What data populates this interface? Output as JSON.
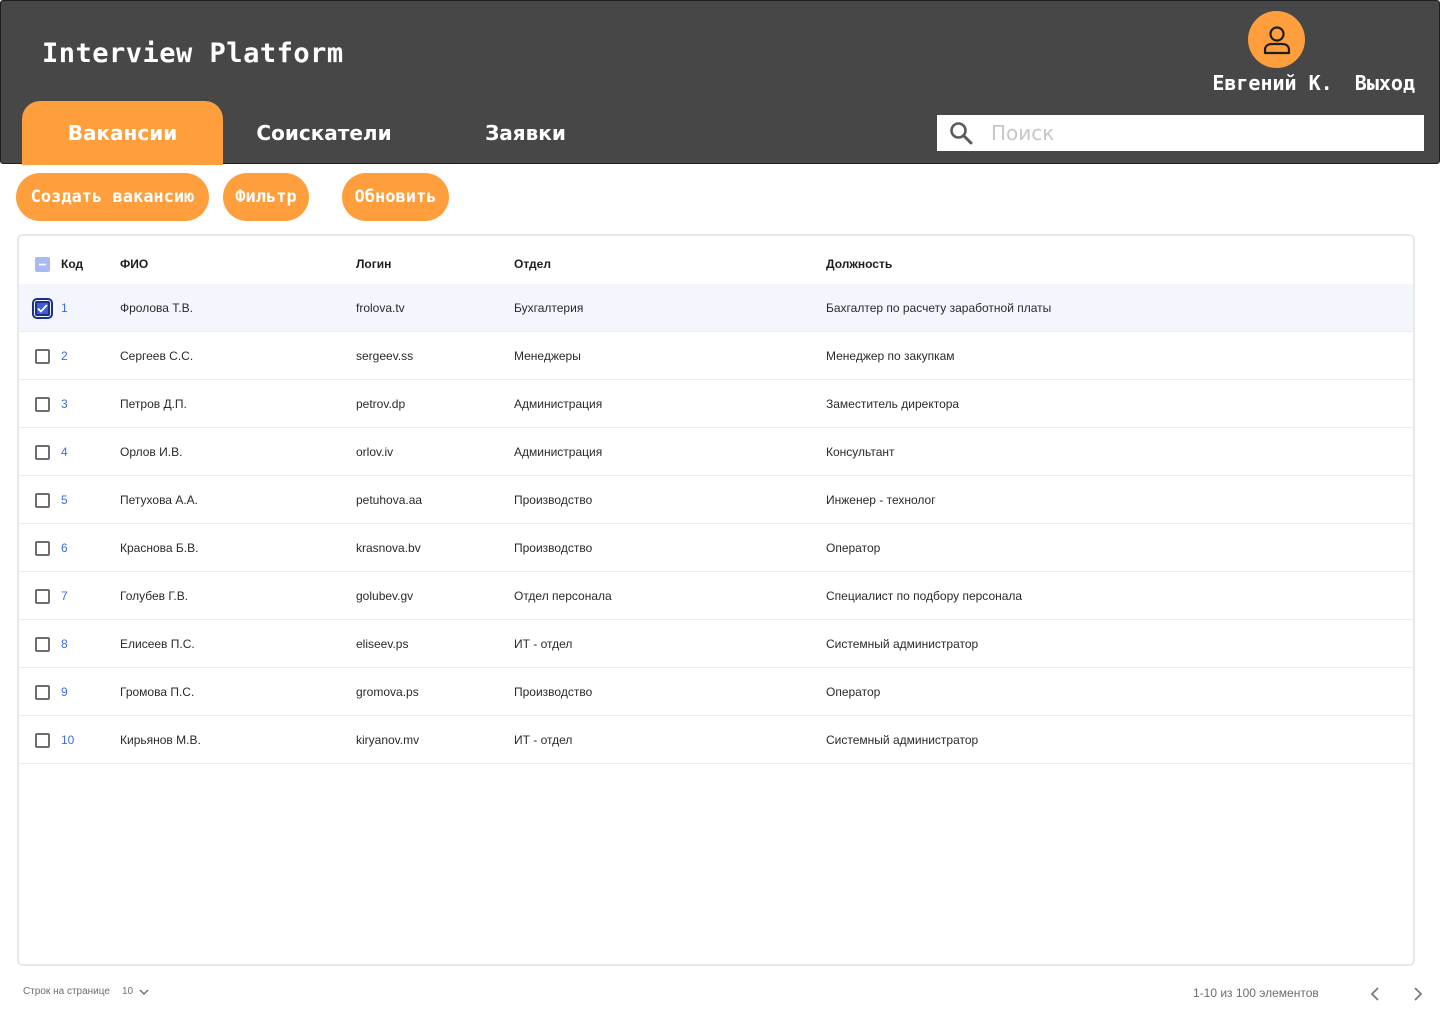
{
  "header": {
    "app_title": "Interview Platform",
    "user_name": "Евгений К.",
    "logout_label": "Выход",
    "avatar_icon": "user-icon",
    "accent_color": "#ff9e3d",
    "bar_color": "#474747"
  },
  "tabs": [
    {
      "label": "Вакансии",
      "active": true
    },
    {
      "label": "Соискатели",
      "active": false
    },
    {
      "label": "Заявки",
      "active": false
    }
  ],
  "search": {
    "placeholder": "Поиск",
    "value": "",
    "icon": "search-icon"
  },
  "toolbar": {
    "create_label": "Создать вакансию",
    "filter_label": "Фильтр",
    "refresh_label": "Обновить"
  },
  "table": {
    "select_all_state": "indeterminate",
    "columns": {
      "code": "Код",
      "fio": "ФИО",
      "login": "Логин",
      "dept": "Отдел",
      "position": "Должность"
    },
    "rows": [
      {
        "checked": true,
        "code": "1",
        "fio": "Фролова Т.В.",
        "login": "frolova.tv",
        "dept": "Бухгалтерия",
        "position": "Бахгалтер по расчету заработной платы"
      },
      {
        "checked": false,
        "code": "2",
        "fio": "Сергеев С.С.",
        "login": "sergeev.ss",
        "dept": "Менеджеры",
        "position": "Менеджер по закупкам"
      },
      {
        "checked": false,
        "code": "3",
        "fio": "Петров Д.П.",
        "login": "petrov.dp",
        "dept": "Администрация",
        "position": "Заместитель директора"
      },
      {
        "checked": false,
        "code": "4",
        "fio": "Орлов И.В.",
        "login": "orlov.iv",
        "dept": "Администрация",
        "position": "Консультант"
      },
      {
        "checked": false,
        "code": "5",
        "fio": "Петухова А.А.",
        "login": "petuhova.aa",
        "dept": "Производство",
        "position": "Инженер - технолог"
      },
      {
        "checked": false,
        "code": "6",
        "fio": "Краснова Б.В.",
        "login": "krasnova.bv",
        "dept": "Производство",
        "position": "Оператор"
      },
      {
        "checked": false,
        "code": "7",
        "fio": "Голубев Г.В.",
        "login": "golubev.gv",
        "dept": "Отдел персонала",
        "position": "Специалист по подбору персонала"
      },
      {
        "checked": false,
        "code": "8",
        "fio": "Елисеев П.С.",
        "login": "eliseev.ps",
        "dept": "ИТ - отдел",
        "position": "Системный администратор"
      },
      {
        "checked": false,
        "code": "9",
        "fio": "Громова П.С.",
        "login": "gromova.ps",
        "dept": "Производство",
        "position": "Оператор"
      },
      {
        "checked": false,
        "code": "10",
        "fio": "Кирьянов М.В.",
        "login": "kiryanov.mv",
        "dept": "ИТ - отдел",
        "position": "Системный администратор"
      }
    ]
  },
  "pagination": {
    "rows_per_page_label": "Строк на странице",
    "rows_per_page_value": "10",
    "range_label": "1-10 из 100 элементов"
  }
}
